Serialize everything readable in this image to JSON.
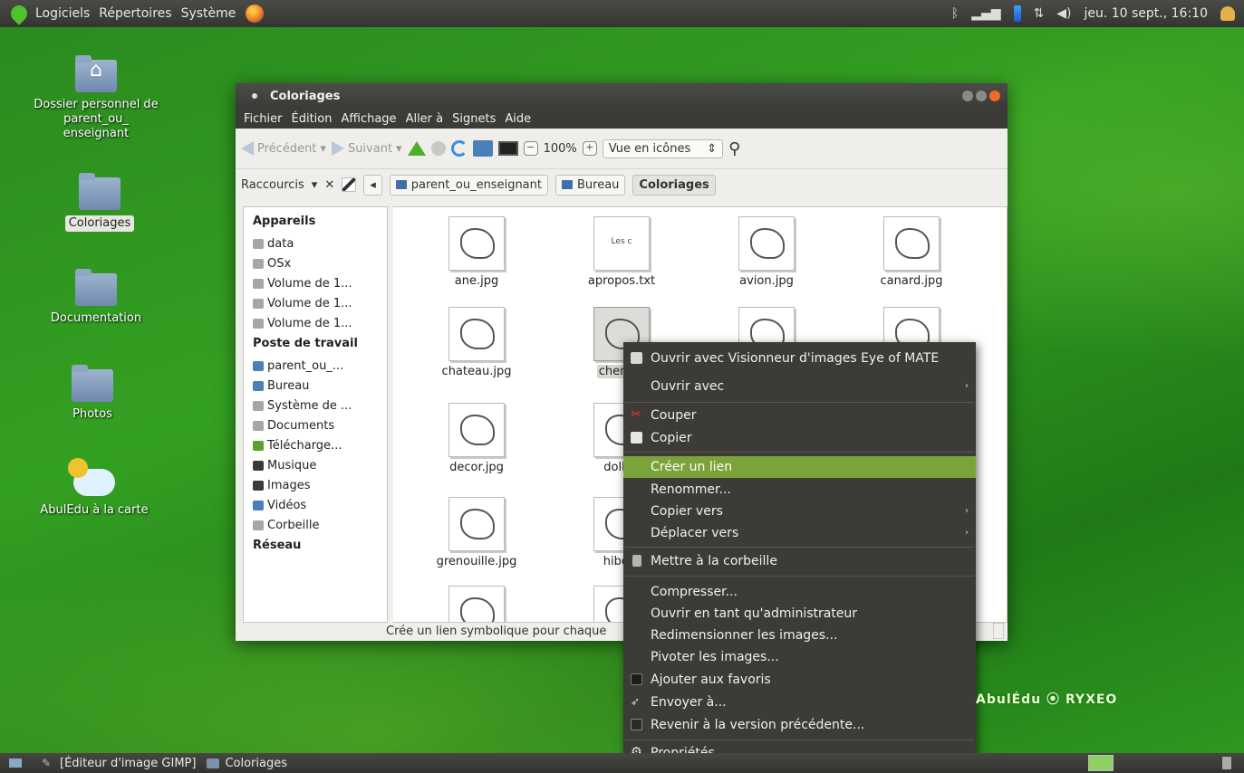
{
  "top_panel": {
    "menus": [
      "Logiciels",
      "Répertoires",
      "Système"
    ],
    "clock": "jeu. 10 sept., 16:10"
  },
  "desktop": {
    "icons": [
      {
        "label": "Dossier personnel de parent_ou_ enseignant",
        "icon": "home-folder-icon"
      },
      {
        "label": "Coloriages",
        "icon": "folder-icon",
        "selected": true
      },
      {
        "label": "Documentation",
        "icon": "folder-icon"
      },
      {
        "label": "Photos",
        "icon": "folder-icon"
      },
      {
        "label": "AbulEdu à la carte",
        "icon": "abuledu-icon"
      }
    ],
    "brand_text": "AbulÉdu ⦿ RYXEO"
  },
  "window": {
    "title": "Coloriages",
    "menubar": [
      "Fichier",
      "Édition",
      "Affichage",
      "Aller à",
      "Signets",
      "Aide"
    ],
    "toolbar": {
      "back": "Précédent",
      "forward": "Suivant",
      "zoom": "100%",
      "view_mode": "Vue en icônes"
    },
    "location": {
      "sidebar_mode": "Raccourcis",
      "breadcrumbs": [
        "parent_ou_enseignant",
        "Bureau",
        "Coloriages"
      ]
    },
    "sidebar": {
      "devices_header": "Appareils",
      "devices": [
        "data",
        "OSx",
        "Volume de 1...",
        "Volume de 1...",
        "Volume de 1..."
      ],
      "places_header": "Poste de travail",
      "places": [
        "parent_ou_...",
        "Bureau",
        "Système de ...",
        "Documents",
        "Télécharge...",
        "Musique",
        "Images",
        "Vidéos",
        "Corbeille"
      ],
      "network_header": "Réseau"
    },
    "files": [
      {
        "name": "ane.jpg"
      },
      {
        "name": "apropos.txt",
        "preview_text": "Les c"
      },
      {
        "name": "avion.jpg"
      },
      {
        "name": "canard.jpg"
      },
      {
        "name": "chateau.jpg"
      },
      {
        "name": "chenille",
        "selected": true
      },
      {
        "name": ""
      },
      {
        "name": ""
      },
      {
        "name": "decor.jpg"
      },
      {
        "name": "doll.jp"
      },
      {
        "name": "grenouille.jpg"
      },
      {
        "name": "hibou."
      },
      {
        "name": ""
      },
      {
        "name": ""
      }
    ],
    "status": "Crée un lien symbolique pour chaque"
  },
  "context_menu": {
    "items": [
      {
        "label": "Ouvrir avec Visionneur d'images Eye of MATE",
        "icon": "eye-of-mate-icon"
      },
      {
        "label": "Ouvrir avec",
        "submenu": true
      },
      {
        "label": "Couper",
        "icon": "scissors-icon"
      },
      {
        "label": "Copier",
        "icon": "copy-icon"
      },
      {
        "label": "Créer un lien",
        "highlighted": true
      },
      {
        "label": "Renommer..."
      },
      {
        "label": "Copier vers",
        "submenu": true
      },
      {
        "label": "Déplacer vers",
        "submenu": true
      },
      {
        "label": "Mettre à la corbeille",
        "icon": "trash-icon"
      },
      {
        "label": "Compresser..."
      },
      {
        "label": "Ouvrir en tant qu'administrateur"
      },
      {
        "label": "Redimensionner les images..."
      },
      {
        "label": "Pivoter les images..."
      },
      {
        "label": "Ajouter aux favoris",
        "icon": "monitor-icon"
      },
      {
        "label": "Envoyer à...",
        "icon": "send-icon"
      },
      {
        "label": "Revenir à la version précédente...",
        "icon": "revert-icon"
      },
      {
        "label": "Propriétés",
        "icon": "gear-icon"
      }
    ]
  },
  "bottom_panel": {
    "tasks": [
      "[Éditeur d'image GIMP]",
      "Coloriages"
    ]
  },
  "colors": {
    "desktop_green": "#2f9a20",
    "panel_dark": "#3c3b37",
    "menu_highlight": "#7aa43a",
    "close_button": "#f06a2a"
  }
}
